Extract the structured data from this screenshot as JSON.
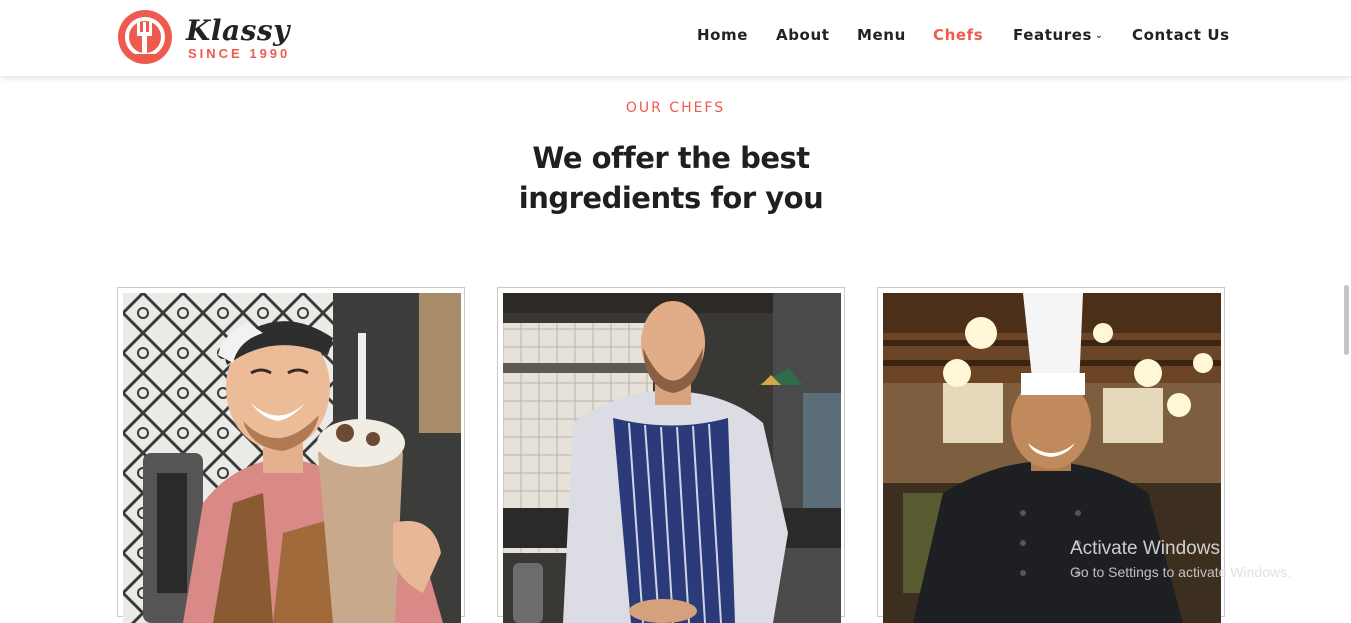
{
  "brand": {
    "name": "Klassy",
    "tagline": "SINCE 1990",
    "accent": "#ef5a4f"
  },
  "nav": {
    "items": [
      {
        "label": "Home"
      },
      {
        "label": "About"
      },
      {
        "label": "Menu"
      },
      {
        "label": "Chefs",
        "active": true
      },
      {
        "label": "Features",
        "has_dropdown": true
      },
      {
        "label": "Contact Us"
      }
    ],
    "dropdown_icon": "chevron-down-icon"
  },
  "section": {
    "eyebrow": "OUR CHEFS",
    "title_line1": "We offer the best",
    "title_line2": "ingredients for you"
  },
  "chefs": [
    {
      "photo": "chef-photo-smiling-barista"
    },
    {
      "photo": "chef-photo-apron-kitchen"
    },
    {
      "photo": "chef-photo-white-hat"
    }
  ],
  "watermark": {
    "title": "Activate Windows",
    "subtitle": "Go to Settings to activate Windows."
  }
}
